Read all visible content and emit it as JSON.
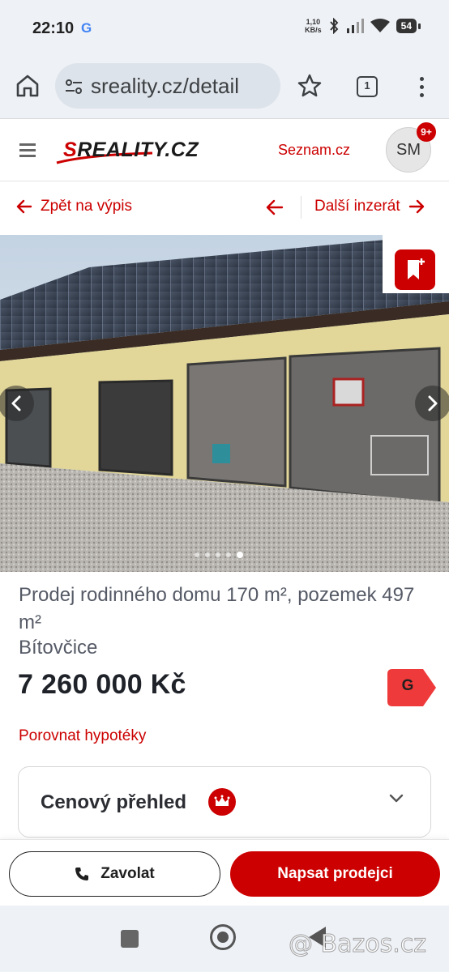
{
  "status_bar": {
    "time": "22:10",
    "google_glyph": "G",
    "net_speed_value": "1,10",
    "net_speed_unit": "KB/s",
    "battery": "54",
    "icons": [
      "bluetooth-icon",
      "signal-icon",
      "wifi-icon",
      "battery-icon"
    ]
  },
  "browser": {
    "url": "sreality.cz/detail",
    "tab_count": "1",
    "icons": [
      "home-icon",
      "site-settings-icon",
      "bookmark-star-icon",
      "tab-switcher-icon",
      "more-menu-icon"
    ]
  },
  "header": {
    "logo_first": "S",
    "logo_rest": "REALITY.CZ",
    "seznam_link": "Seznam.cz",
    "avatar_initials": "SM",
    "notification_badge": "9+"
  },
  "nav": {
    "back_label": "Zpět na výpis",
    "next_label": "Další inzerát"
  },
  "gallery": {
    "total_dots": 5,
    "active_index": 4
  },
  "listing": {
    "title": "Prodej rodinného domu 170 m², pozemek 497 m²",
    "location": "Bítovčice",
    "price": "7 260 000 Kč",
    "energy_class": "G",
    "mortgage_link": "Porovnat hypotéky",
    "price_overview_label": "Cenový přehled"
  },
  "actions": {
    "call_label": "Zavolat",
    "write_label": "Napsat prodejci"
  },
  "watermark": "@ Bazos.cz",
  "colors": {
    "brand_red": "#cc0000",
    "browser_chrome": "#eef1f6",
    "text_dark": "#1f2329",
    "text_muted": "#555a66"
  }
}
